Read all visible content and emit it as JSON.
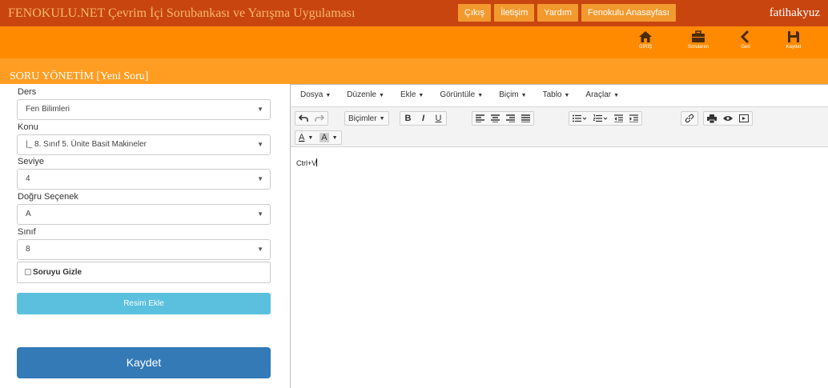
{
  "header": {
    "site_title": "FENOKULU.NET Çevrim İçi Sorubankası ve Yarışma Uygulaması",
    "nav": [
      "Çıkış",
      "İletişim",
      "Yardım",
      "Fenokulu Anasayfası"
    ],
    "user": "fatihakyuz"
  },
  "toolbar": {
    "items": [
      {
        "label": "GİRİŞ",
        "icon": "home-icon"
      },
      {
        "label": "Sorularım",
        "icon": "briefcase-icon"
      },
      {
        "label": "Geri",
        "icon": "chevron-left-icon"
      },
      {
        "label": "Kaydet",
        "icon": "save-icon"
      }
    ]
  },
  "page": {
    "title": "SORU YÖNETİM [Yeni Soru]"
  },
  "form": {
    "ders_label": "Ders",
    "ders_value": "Fen Bilimleri",
    "konu_label": "Konu",
    "konu_value": "|_ 8. Sınıf 5. Ünite Basit Makineler",
    "seviye_label": "Seviye",
    "seviye_value": "4",
    "dogru_label": "Doğru Seçenek",
    "dogru_value": "A",
    "sinif_label": "Sınıf",
    "sinif_value": "8",
    "hide_label": "Soruyu Gizle",
    "image_button": "Resim Ekle",
    "save_button": "Kaydet"
  },
  "editor": {
    "menus": [
      "Dosya",
      "Düzenle",
      "Ekle",
      "Görüntüle",
      "Biçim",
      "Tablo",
      "Araçlar"
    ],
    "formats_label": "Biçimler",
    "bold": "B",
    "italic": "I",
    "underline": "U",
    "text_color": "A",
    "bg_color": "A",
    "content": "Ctrl+V"
  }
}
